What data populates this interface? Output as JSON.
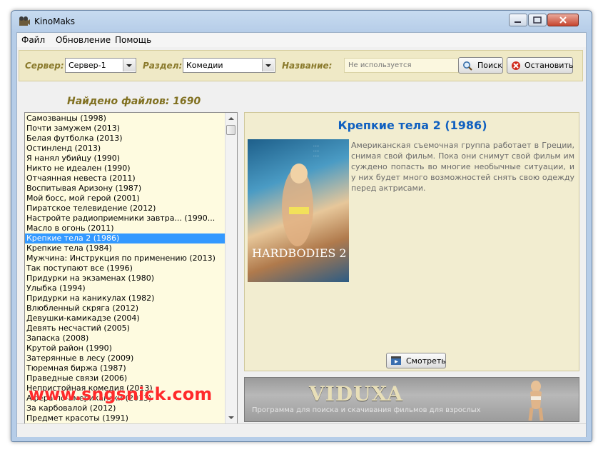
{
  "window": {
    "title": "KinoMaks"
  },
  "menu": {
    "items": [
      "Файл",
      "Обновление",
      "Помощь"
    ]
  },
  "toolbar": {
    "server_label": "Сервер:",
    "server_value": "Сервер-1",
    "section_label": "Раздел:",
    "section_value": "Комедии",
    "name_label": "Название:",
    "name_placeholder": "Не используется",
    "search_label": "Поиск",
    "stop_label": "Остановить"
  },
  "found_text": "Найдено файлов: 1690",
  "list": {
    "selected_index": 12,
    "items": [
      "Самозванцы (1998)",
      "Почти замужем (2013)",
      "Белая футболка (2013)",
      "Остинленд (2013)",
      "Я нанял убийцу (1990)",
      "Никто не идеален (1990)",
      "Отчаянная невеста (2011)",
      "Воспитывая Аризону (1987)",
      "Мой босс, мой герой (2001)",
      "Пиратское телевидение (2012)",
      "Настройте радиоприемники завтра... (1990...",
      "Масло в огонь (2011)",
      "Крепкие тела 2 (1986)",
      "Крепкие тела (1984)",
      "Мужчина: Инструкция по применению (2013)",
      "Так поступают все (1996)",
      "Придурки на экзаменах (1980)",
      "Улыбка (1994)",
      "Придурки на каникулах (1982)",
      "Влюбленный скряга (2012)",
      "Девушки-камикадзе (2004)",
      "Девять несчастий (2005)",
      "Запаска (2008)",
      "Крутой район (1990)",
      "Затерянные в лесу (2009)",
      "Тюремная биржа (1987)",
      "Праведные связи (2006)",
      "Непристойная комедия (2013)",
      "Афера по-американски (2013)",
      "За карбовалой (2012)",
      "Предмет красоты (1991)"
    ]
  },
  "detail": {
    "title": "Крепкие тела 2 (1986)",
    "poster_text": "HARDBODIES 2",
    "description": "Американская съемочная группа работает в Греции, снимая свой фильм. Пока они снимут свой фильм им суждено попасть во многие необычные ситуации, и у них будет много возможностей снять свою одежду перед актрисами.",
    "watch_label": "Смотреть"
  },
  "banner": {
    "title": "VIDUXA",
    "subtitle": "Программа для поиска и скачивания фильмов для взрослых"
  },
  "watermark": "www.sngsnick.com"
}
